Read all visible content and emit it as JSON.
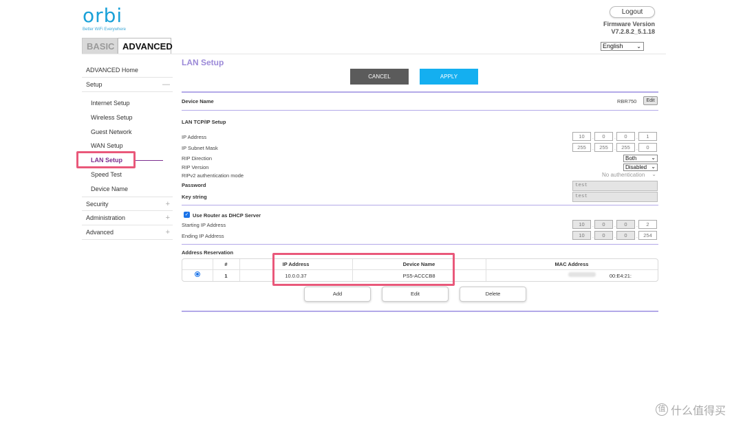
{
  "brand": {
    "logo_text": "orbi",
    "tagline": "Better WiFi Everywhere"
  },
  "tabs": {
    "basic": "BASIC",
    "advanced": "ADVANCED"
  },
  "header": {
    "logout": "Logout",
    "firmware_label": "Firmware Version",
    "firmware_value": "V7.2.8.2_5.1.18",
    "language": "English"
  },
  "sidebar": {
    "home": "ADVANCED Home",
    "setup": "Setup",
    "setup_items": [
      "Internet Setup",
      "Wireless Setup",
      "Guest Network",
      "WAN Setup",
      "LAN Setup",
      "Speed Test",
      "Device Name"
    ],
    "security": "Security",
    "administration": "Administration",
    "advanced": "Advanced"
  },
  "page": {
    "title": "LAN Setup",
    "cancel": "CANCEL",
    "apply": "APPLY"
  },
  "device": {
    "label": "Device Name",
    "value": "RBR750",
    "edit": "Edit"
  },
  "tcpip": {
    "section": "LAN TCP/IP Setup",
    "ip_label": "IP Address",
    "ip": [
      "10",
      "0",
      "0",
      "1"
    ],
    "mask_label": "IP Subnet Mask",
    "mask": [
      "255",
      "255",
      "255",
      "0"
    ],
    "rip_dir_label": "RIP Direction",
    "rip_dir": "Both",
    "rip_ver_label": "RIP Version",
    "rip_ver": "Disabled",
    "ripv2_label": "RIPv2 authentication mode",
    "ripv2": "No authentication",
    "password_label": "Password",
    "password": "test",
    "key_label": "Key string",
    "key": "test"
  },
  "dhcp": {
    "checkbox_label": "Use Router as DHCP Server",
    "start_label": "Starting IP Address",
    "start": [
      "10",
      "0",
      "0",
      "2"
    ],
    "end_label": "Ending IP Address",
    "end": [
      "10",
      "0",
      "0",
      "254"
    ]
  },
  "reservation": {
    "section": "Address Reservation",
    "columns": {
      "num": "#",
      "ip": "IP Address",
      "name": "Device Name",
      "mac": "MAC Address"
    },
    "rows": [
      {
        "num": "1",
        "ip": "10.0.0.37",
        "name": "PS5-ACCCB8",
        "mac": "00:E4:21:"
      }
    ],
    "add": "Add",
    "edit": "Edit",
    "delete": "Delete"
  },
  "watermark": "什么值得买",
  "colors": {
    "brand_blue": "#1aa1d8",
    "title_purple": "#9c8ad8",
    "active_purple": "#7b2d8e",
    "apply_blue": "#14aff0",
    "cancel_gray": "#5b5b5b",
    "rule_lavender": "#b2a8e8",
    "highlight_pink": "#e9587a"
  }
}
